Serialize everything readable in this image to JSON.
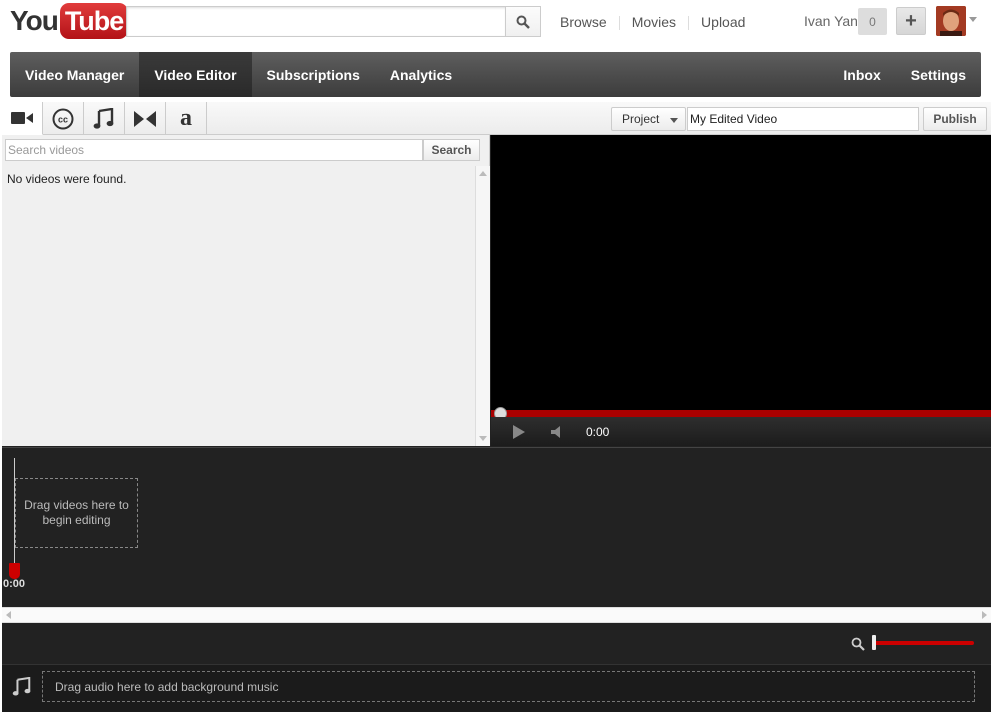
{
  "masthead": {
    "logo_you": "You",
    "logo_tube": "Tube",
    "links": [
      "Browse",
      "Movies",
      "Upload"
    ],
    "user_name": "Ivan Yan",
    "notification_count": "0",
    "plus_label": "+"
  },
  "nav": {
    "left": [
      "Video Manager",
      "Video Editor",
      "Subscriptions",
      "Analytics"
    ],
    "right": [
      "Inbox",
      "Settings"
    ],
    "active": "Video Editor"
  },
  "toolbar": {
    "tabs": [
      "video-camera-icon",
      "closed-caption-icon",
      "music-note-icon",
      "transition-icon",
      "text-icon"
    ],
    "text_tab_glyph": "a",
    "project_label": "Project",
    "project_title": "My Edited Video",
    "publish_label": "Publish"
  },
  "library": {
    "search_placeholder": "Search videos",
    "search_button": "Search",
    "empty_message": "No videos were found."
  },
  "player": {
    "time": "0:00",
    "progress": 0
  },
  "timeline": {
    "playhead_time": "0:00",
    "drop_video_text": "Drag videos here to begin editing"
  },
  "audio": {
    "drop_text": "Drag audio here to add background music"
  },
  "colors": {
    "accent_red": "#cc0000",
    "nav_bg": "#4a4a4a",
    "editor_bg": "#222222"
  }
}
